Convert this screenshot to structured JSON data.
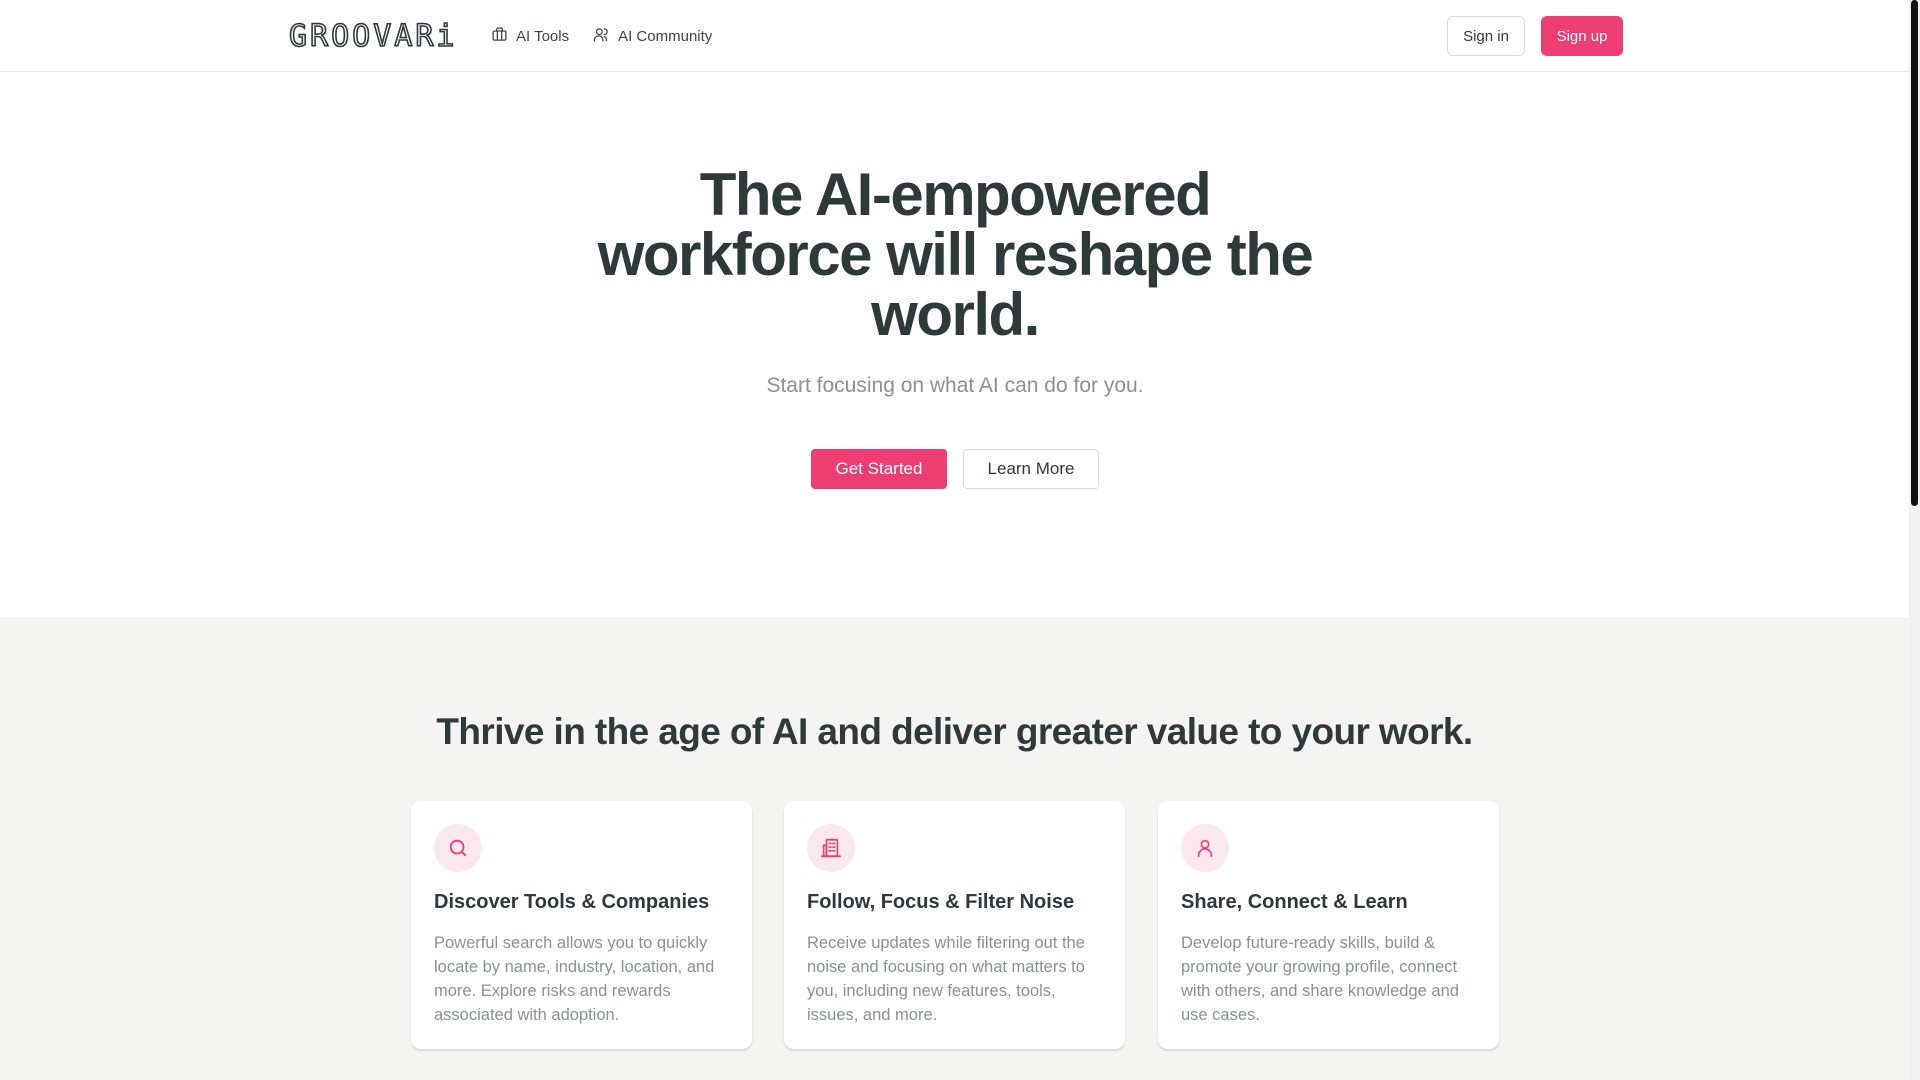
{
  "header": {
    "logo": "GROOVARi",
    "nav": [
      {
        "label": "AI Tools",
        "icon": "briefcase-icon"
      },
      {
        "label": "AI Community",
        "icon": "users-icon"
      }
    ],
    "sign_in": "Sign in",
    "sign_up": "Sign up"
  },
  "hero": {
    "title": "The AI-empowered workforce will reshape the world.",
    "subtitle": "Start focusing on what AI can do for you.",
    "primary_cta": "Get Started",
    "secondary_cta": "Learn More"
  },
  "features": {
    "title": "Thrive in the age of AI and deliver greater value to your work.",
    "cards": [
      {
        "icon": "search-icon",
        "title": "Discover Tools & Companies",
        "text": "Powerful search allows you to quickly locate by name, industry, location, and more. Explore risks and rewards associated with adoption."
      },
      {
        "icon": "building-icon",
        "title": "Follow, Focus & Filter Noise",
        "text": "Receive updates while filtering out the noise and focusing on what matters to you, including new features, tools, issues, and more."
      },
      {
        "icon": "user-icon",
        "title": "Share, Connect & Learn",
        "text": "Develop future-ready skills, build & promote your growing profile, connect with others, and share knowledge and use cases."
      }
    ]
  },
  "colors": {
    "accent": "#ee3d72",
    "text_dark": "#2d3a3a",
    "text_muted": "#8a9291",
    "section_bg": "#f4f4f3",
    "icon_bg": "#fde7ee"
  }
}
